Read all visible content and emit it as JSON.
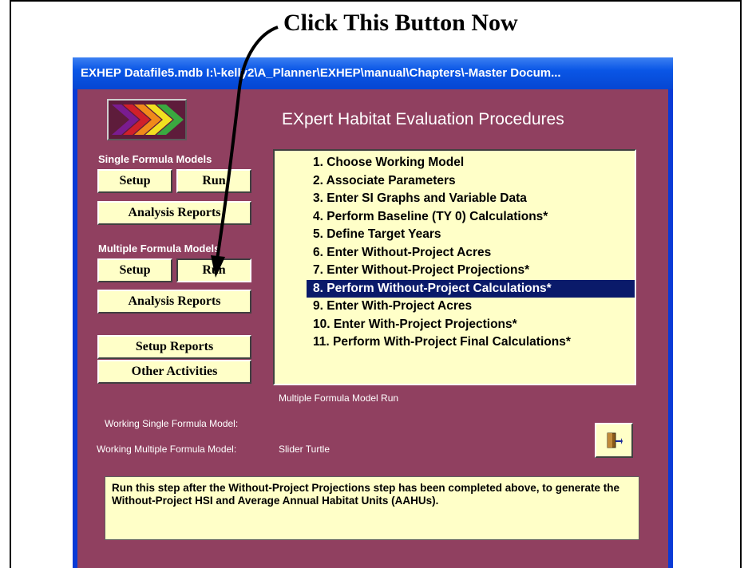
{
  "annotation": {
    "text": "Click This Button Now"
  },
  "window": {
    "title": "EXHEP   Datafile5.mdb  I:\\-kelly2\\A_Planner\\EXHEP\\manual\\Chapters\\-Master Docum..."
  },
  "app": {
    "title": "EXpert Habitat Evaluation Procedures"
  },
  "single_formula": {
    "label": "Single Formula Models",
    "setup_label": "Setup",
    "run_label": "Run",
    "analysis_label": "Analysis Reports"
  },
  "multiple_formula": {
    "label": "Multiple Formula Models",
    "setup_label": "Setup",
    "run_label": "Run",
    "analysis_label": "Analysis Reports"
  },
  "buttons": {
    "setup_reports_label": "Setup Reports",
    "other_activities_label": "Other Activities"
  },
  "steps": [
    "1.  Choose Working Model",
    "2.  Associate Parameters",
    "3.  Enter SI Graphs and Variable Data",
    "4.  Perform Baseline (TY 0) Calculations*",
    "5.  Define Target Years",
    "6.  Enter Without-Project Acres",
    "7.  Enter Without-Project Projections*",
    "8.  Perform Without-Project Calculations*",
    "9.  Enter With-Project Acres",
    "10. Enter With-Project Projections*",
    "11. Perform With-Project Final Calculations*"
  ],
  "selected_step_index": 7,
  "status": {
    "mode_text": "Multiple Formula Model Run",
    "working_single_label": "Working Single Formula Model:",
    "working_single_value": "",
    "working_multiple_label": "Working Multiple Formula Model:",
    "working_multiple_value": "Slider Turtle"
  },
  "help_text": "Run this step after the Without-Project Projections step has been completed above, to generate the Without-Project HSI and Average Annual Habitat Units (AAHUs).",
  "icons": {
    "exit": "exit-door-icon",
    "logo": "chevron-logo-icon"
  },
  "colors": {
    "client_bg": "#904060",
    "button_bg": "#ffffc8",
    "selection": "#0a1a6a",
    "titlebar": "#0a56e6"
  }
}
